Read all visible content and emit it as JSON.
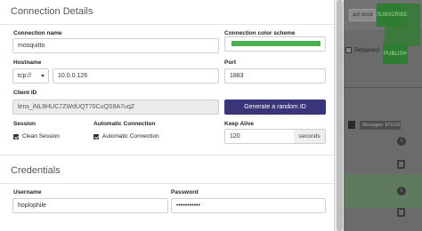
{
  "modal": {
    "connection_details_title": "Connection Details",
    "connection_name": {
      "label": "Connection name",
      "value": "mosquitto"
    },
    "color_scheme": {
      "label": "Connection color scheme",
      "color": "#4caf50"
    },
    "hostname": {
      "label": "Hostname",
      "protocol": "tcp://",
      "host": "10.0.0.126"
    },
    "port": {
      "label": "Port",
      "value": "1883"
    },
    "client_id": {
      "label": "Client ID",
      "value": "lens_iNL9HUC7ZWdUQT70CuQS9A7uqZ",
      "generate_button": "Generate a random ID"
    },
    "session": {
      "label": "Session",
      "clean_session_label": "Clean Session",
      "clean_session_checked": true
    },
    "automatic_connection": {
      "label": "Automatic Connection",
      "option_label": "Automatic Connection",
      "checked": true
    },
    "keep_alive": {
      "label": "Keep Alive",
      "value": "120",
      "unit": "seconds"
    },
    "credentials_title": "Credentials",
    "username": {
      "label": "Username",
      "value": "hoplophile"
    },
    "password": {
      "label": "Password",
      "value": "•••••••••••"
    }
  },
  "background": {
    "select_text": "ast once",
    "subscribe_label": "SUBSCRIBE",
    "retained_label": "Retained",
    "publish_label": "PUBLISH",
    "messages_badge": "Messages: 871633"
  }
}
